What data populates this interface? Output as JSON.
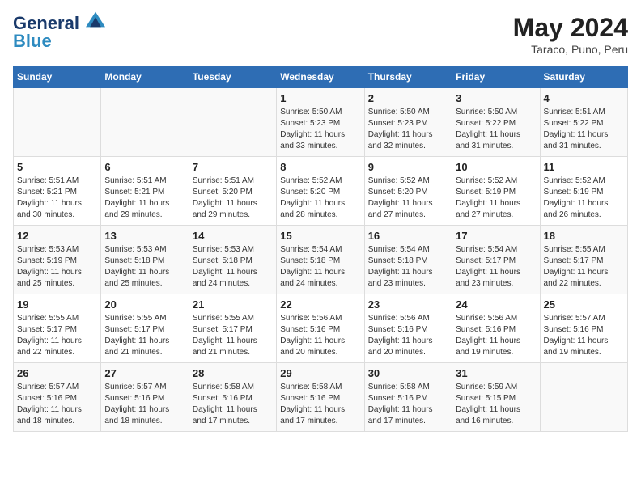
{
  "header": {
    "logo_line1": "General",
    "logo_line2": "Blue",
    "title": "May 2024",
    "subtitle": "Taraco, Puno, Peru"
  },
  "weekdays": [
    "Sunday",
    "Monday",
    "Tuesday",
    "Wednesday",
    "Thursday",
    "Friday",
    "Saturday"
  ],
  "weeks": [
    [
      {
        "day": "",
        "info": ""
      },
      {
        "day": "",
        "info": ""
      },
      {
        "day": "",
        "info": ""
      },
      {
        "day": "1",
        "info": "Sunrise: 5:50 AM\nSunset: 5:23 PM\nDaylight: 11 hours\nand 33 minutes."
      },
      {
        "day": "2",
        "info": "Sunrise: 5:50 AM\nSunset: 5:23 PM\nDaylight: 11 hours\nand 32 minutes."
      },
      {
        "day": "3",
        "info": "Sunrise: 5:50 AM\nSunset: 5:22 PM\nDaylight: 11 hours\nand 31 minutes."
      },
      {
        "day": "4",
        "info": "Sunrise: 5:51 AM\nSunset: 5:22 PM\nDaylight: 11 hours\nand 31 minutes."
      }
    ],
    [
      {
        "day": "5",
        "info": "Sunrise: 5:51 AM\nSunset: 5:21 PM\nDaylight: 11 hours\nand 30 minutes."
      },
      {
        "day": "6",
        "info": "Sunrise: 5:51 AM\nSunset: 5:21 PM\nDaylight: 11 hours\nand 29 minutes."
      },
      {
        "day": "7",
        "info": "Sunrise: 5:51 AM\nSunset: 5:20 PM\nDaylight: 11 hours\nand 29 minutes."
      },
      {
        "day": "8",
        "info": "Sunrise: 5:52 AM\nSunset: 5:20 PM\nDaylight: 11 hours\nand 28 minutes."
      },
      {
        "day": "9",
        "info": "Sunrise: 5:52 AM\nSunset: 5:20 PM\nDaylight: 11 hours\nand 27 minutes."
      },
      {
        "day": "10",
        "info": "Sunrise: 5:52 AM\nSunset: 5:19 PM\nDaylight: 11 hours\nand 27 minutes."
      },
      {
        "day": "11",
        "info": "Sunrise: 5:52 AM\nSunset: 5:19 PM\nDaylight: 11 hours\nand 26 minutes."
      }
    ],
    [
      {
        "day": "12",
        "info": "Sunrise: 5:53 AM\nSunset: 5:19 PM\nDaylight: 11 hours\nand 25 minutes."
      },
      {
        "day": "13",
        "info": "Sunrise: 5:53 AM\nSunset: 5:18 PM\nDaylight: 11 hours\nand 25 minutes."
      },
      {
        "day": "14",
        "info": "Sunrise: 5:53 AM\nSunset: 5:18 PM\nDaylight: 11 hours\nand 24 minutes."
      },
      {
        "day": "15",
        "info": "Sunrise: 5:54 AM\nSunset: 5:18 PM\nDaylight: 11 hours\nand 24 minutes."
      },
      {
        "day": "16",
        "info": "Sunrise: 5:54 AM\nSunset: 5:18 PM\nDaylight: 11 hours\nand 23 minutes."
      },
      {
        "day": "17",
        "info": "Sunrise: 5:54 AM\nSunset: 5:17 PM\nDaylight: 11 hours\nand 23 minutes."
      },
      {
        "day": "18",
        "info": "Sunrise: 5:55 AM\nSunset: 5:17 PM\nDaylight: 11 hours\nand 22 minutes."
      }
    ],
    [
      {
        "day": "19",
        "info": "Sunrise: 5:55 AM\nSunset: 5:17 PM\nDaylight: 11 hours\nand 22 minutes."
      },
      {
        "day": "20",
        "info": "Sunrise: 5:55 AM\nSunset: 5:17 PM\nDaylight: 11 hours\nand 21 minutes."
      },
      {
        "day": "21",
        "info": "Sunrise: 5:55 AM\nSunset: 5:17 PM\nDaylight: 11 hours\nand 21 minutes."
      },
      {
        "day": "22",
        "info": "Sunrise: 5:56 AM\nSunset: 5:16 PM\nDaylight: 11 hours\nand 20 minutes."
      },
      {
        "day": "23",
        "info": "Sunrise: 5:56 AM\nSunset: 5:16 PM\nDaylight: 11 hours\nand 20 minutes."
      },
      {
        "day": "24",
        "info": "Sunrise: 5:56 AM\nSunset: 5:16 PM\nDaylight: 11 hours\nand 19 minutes."
      },
      {
        "day": "25",
        "info": "Sunrise: 5:57 AM\nSunset: 5:16 PM\nDaylight: 11 hours\nand 19 minutes."
      }
    ],
    [
      {
        "day": "26",
        "info": "Sunrise: 5:57 AM\nSunset: 5:16 PM\nDaylight: 11 hours\nand 18 minutes."
      },
      {
        "day": "27",
        "info": "Sunrise: 5:57 AM\nSunset: 5:16 PM\nDaylight: 11 hours\nand 18 minutes."
      },
      {
        "day": "28",
        "info": "Sunrise: 5:58 AM\nSunset: 5:16 PM\nDaylight: 11 hours\nand 17 minutes."
      },
      {
        "day": "29",
        "info": "Sunrise: 5:58 AM\nSunset: 5:16 PM\nDaylight: 11 hours\nand 17 minutes."
      },
      {
        "day": "30",
        "info": "Sunrise: 5:58 AM\nSunset: 5:16 PM\nDaylight: 11 hours\nand 17 minutes."
      },
      {
        "day": "31",
        "info": "Sunrise: 5:59 AM\nSunset: 5:15 PM\nDaylight: 11 hours\nand 16 minutes."
      },
      {
        "day": "",
        "info": ""
      }
    ]
  ]
}
